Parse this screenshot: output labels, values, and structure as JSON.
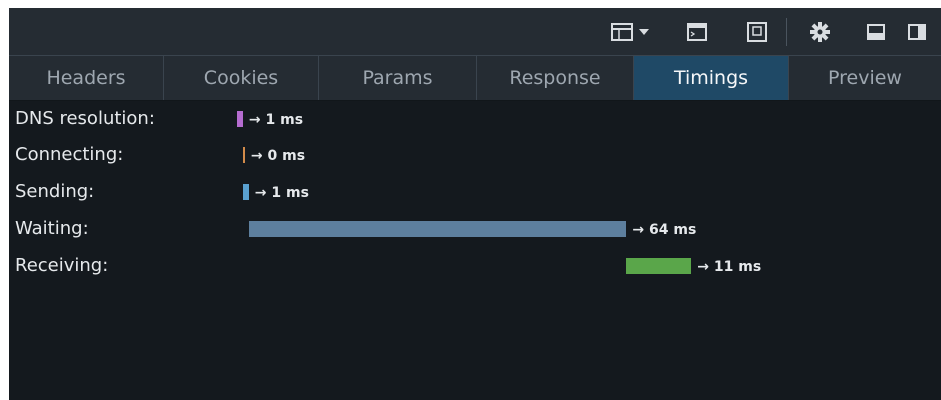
{
  "toolbar": {
    "icons": [
      "layout-split-icon",
      "chevron-down-icon",
      "console-icon",
      "responsive-icon",
      "gear-icon",
      "dock-bottom-icon",
      "dock-side-icon"
    ]
  },
  "tabs": [
    {
      "label": "Headers",
      "active": false
    },
    {
      "label": "Cookies",
      "active": false
    },
    {
      "label": "Params",
      "active": false
    },
    {
      "label": "Response",
      "active": false
    },
    {
      "label": "Timings",
      "active": true
    },
    {
      "label": "Preview",
      "active": false
    }
  ],
  "timings": [
    {
      "label": "DNS resolution:",
      "value": "→ 1 ms",
      "ms": 1,
      "color": "#b56cd0"
    },
    {
      "label": "Connecting:",
      "value": "→ 0 ms",
      "ms": 0,
      "color": "#d28b4a"
    },
    {
      "label": "Sending:",
      "value": "→ 1 ms",
      "ms": 1,
      "color": "#5aa1d1"
    },
    {
      "label": "Waiting:",
      "value": "→ 64 ms",
      "ms": 64,
      "color": "#5d7f9e"
    },
    {
      "label": "Receiving:",
      "value": "→ 11 ms",
      "ms": 11,
      "color": "#5aa64a"
    }
  ]
}
